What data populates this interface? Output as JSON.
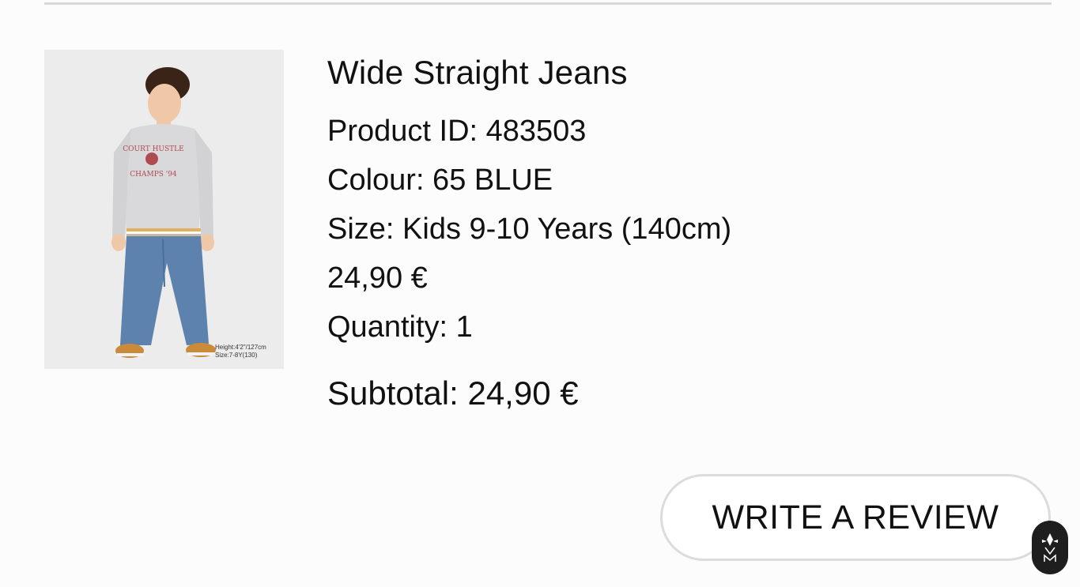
{
  "product": {
    "name": "Wide Straight Jeans",
    "product_id": "Product ID: 483503",
    "colour": "Colour: 65 BLUE",
    "size": "Size: Kids 9-10 Years (140cm)",
    "price": "24,90 €",
    "quantity": "Quantity: 1",
    "subtotal": "Subtotal: 24,90 €"
  },
  "image": {
    "caption_line1": "Height:4'2\"/127cm",
    "caption_line2": "Size:7-8Y(130)",
    "sweatshirt_text_top": "COURT HUSTLE",
    "sweatshirt_text_bottom": "CHAMPS '94"
  },
  "actions": {
    "review_label": "WRITE A REVIEW"
  },
  "badge": {
    "icon": "assistant-logo-icon"
  }
}
